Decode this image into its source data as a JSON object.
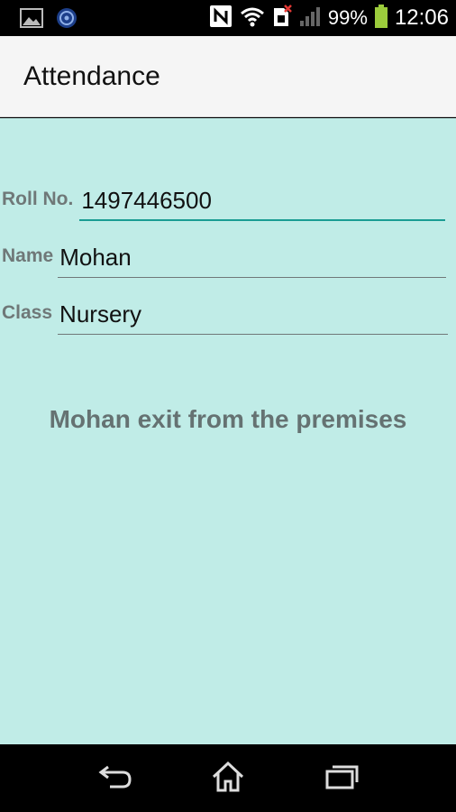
{
  "status_bar": {
    "battery_percent": "99%",
    "time": "12:06",
    "icons": [
      "image-icon",
      "app-notification-icon",
      "nfc-icon",
      "wifi-icon",
      "sim-alert-icon",
      "signal-icon",
      "battery-icon"
    ]
  },
  "app_bar": {
    "title": "Attendance"
  },
  "form": {
    "roll_label": "Roll No.",
    "roll_value": "1497446500",
    "name_label": "Name",
    "name_value": "Mohan",
    "class_label": "Class",
    "class_value": "Nursery"
  },
  "message": "Mohan  exit from the premises",
  "colors": {
    "background": "#c0ece7",
    "accent": "#1a9c93",
    "label": "#6f7878",
    "message": "#657272"
  },
  "nav_bar": {
    "icons": [
      "back-icon",
      "home-icon",
      "recent-apps-icon"
    ]
  }
}
